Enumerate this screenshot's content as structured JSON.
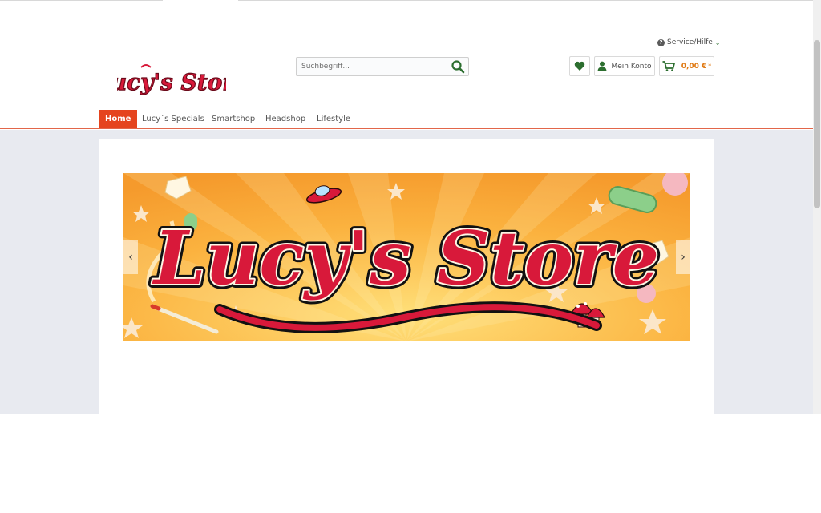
{
  "header": {
    "service_label": "Service/Hilfe",
    "logo_text": "Lucy's Store",
    "search": {
      "placeholder": "Suchbegriff..."
    },
    "account_label": "Mein Konto",
    "cart_amount": "0,00 €",
    "cart_star": "*"
  },
  "nav": {
    "items": [
      {
        "label": "Home"
      },
      {
        "label": "Lucy´s Specials"
      },
      {
        "label": "Smartshop"
      },
      {
        "label": "Headshop"
      },
      {
        "label": "Lifestyle"
      }
    ]
  },
  "banner": {
    "text_main": "Lucy's Store",
    "prev_arrow": "‹",
    "next_arrow": "›"
  },
  "colors": {
    "brand_red": "#d8193a",
    "nav_active": "#e5441e",
    "accent_green": "#2c6e2f",
    "cart_orange": "#e07a14",
    "banner_orange": "#f9a933"
  }
}
